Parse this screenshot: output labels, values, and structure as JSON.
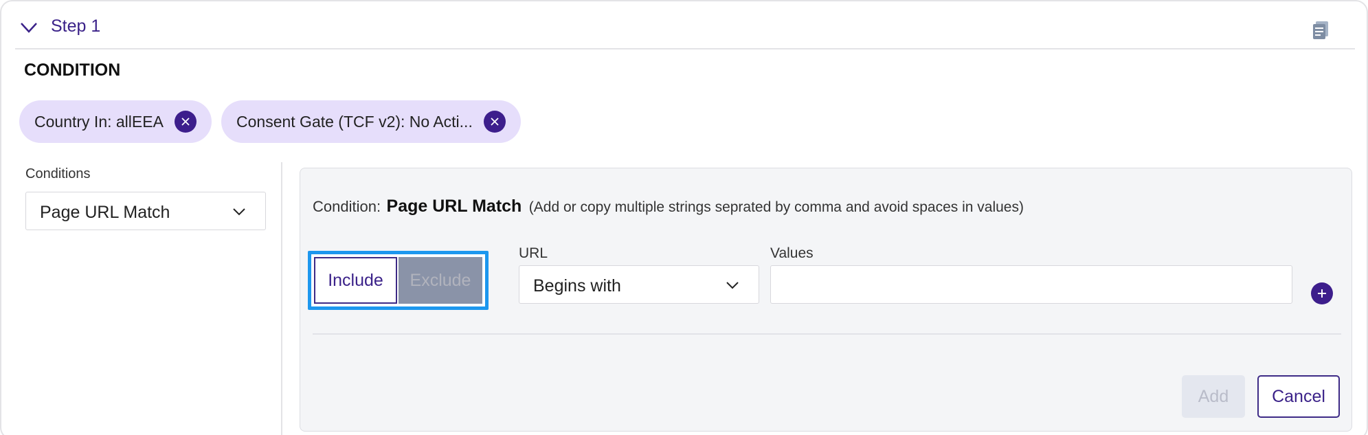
{
  "step": {
    "title": "Step 1"
  },
  "condition_section": {
    "title": "CONDITION",
    "chips": [
      {
        "label": "Country In: allEEA"
      },
      {
        "label": "Consent Gate (TCF v2): No Acti..."
      }
    ]
  },
  "left_panel": {
    "label": "Conditions",
    "selected": "Page URL Match"
  },
  "editor": {
    "prefix": "Condition:",
    "name": "Page URL Match",
    "hint": "(Add or copy multiple strings seprated by comma and avoid spaces in values)",
    "toggle": {
      "include_label": "Include",
      "exclude_label": "Exclude",
      "selected": "Include"
    },
    "url": {
      "label": "URL",
      "selected": "Begins with"
    },
    "values": {
      "label": "Values",
      "value": "",
      "placeholder": ""
    },
    "add_label": "Add",
    "cancel_label": "Cancel"
  },
  "colors": {
    "accent": "#3d1e8c",
    "chip_bg": "#e6defb",
    "focus_ring": "#1d97ee",
    "panel_bg": "#f4f5f7"
  }
}
